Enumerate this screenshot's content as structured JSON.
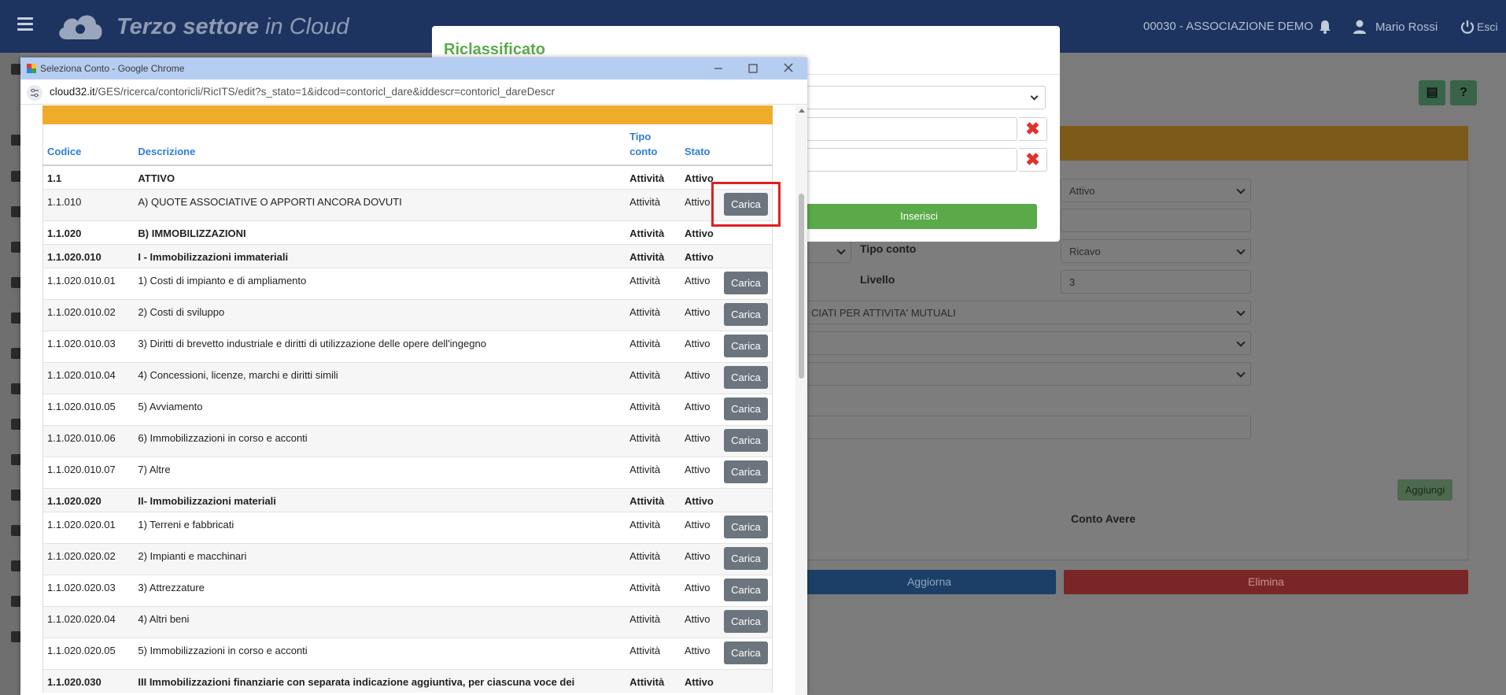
{
  "app": {
    "brand_bold": "Terzo settore",
    "brand_light": " in Cloud",
    "organization": "00030 - ASSOCIAZIONE DEMO",
    "user": "Mario Rossi",
    "logout": "Esci"
  },
  "background_form": {
    "stato_value": "Attivo",
    "tipo_conto_label": "Tipo conto",
    "tipo_conto_value": "Ricavo",
    "livello_label": "Livello",
    "livello_value": "3",
    "category_value": "CIATI PER ATTIVITA' MUTUALI",
    "aggiungi_label": "Aggiungi",
    "conto_avere_label": "Conto Avere",
    "aggiorna_label": "Aggiorna",
    "elimina_label": "Elimina"
  },
  "modal": {
    "title": "Riclassificato",
    "inserisci_label": "Inserisci",
    "clear_symbol": "✖"
  },
  "popup": {
    "window_title": "Seleziona Conto - Google Chrome",
    "url_host": "cloud32.it",
    "url_path": "/GES/ricerca/contoricli/RicITS/edit?s_stato=1&idcod=contoricl_dare&iddescr=contoricl_dareDescr",
    "table": {
      "headers": {
        "codice": "Codice",
        "descrizione": "Descrizione",
        "tipo_line1": "Tipo",
        "tipo_line2": "conto",
        "stato": "Stato"
      },
      "action_label": "Carica",
      "rows": [
        {
          "code": "1.1",
          "desc": "ATTIVO",
          "tipo": "Attività",
          "stato": "Attivo",
          "group": true
        },
        {
          "code": "1.1.010",
          "desc": "A) QUOTE ASSOCIATIVE O APPORTI ANCORA DOVUTI",
          "tipo": "Attività",
          "stato": "Attivo",
          "group": false
        },
        {
          "code": "1.1.020",
          "desc": "B) IMMOBILIZZAZIONI",
          "tipo": "Attività",
          "stato": "Attivo",
          "group": true
        },
        {
          "code": "1.1.020.010",
          "desc": "I - Immobilizzazioni immateriali",
          "tipo": "Attività",
          "stato": "Attivo",
          "group": true
        },
        {
          "code": "1.1.020.010.01",
          "desc": "1) Costi di impianto e di ampliamento",
          "tipo": "Attività",
          "stato": "Attivo",
          "group": false
        },
        {
          "code": "1.1.020.010.02",
          "desc": "2) Costi di sviluppo",
          "tipo": "Attività",
          "stato": "Attivo",
          "group": false
        },
        {
          "code": "1.1.020.010.03",
          "desc": "3) Diritti di brevetto industriale e diritti di utilizzazione delle opere dell'ingegno",
          "tipo": "Attività",
          "stato": "Attivo",
          "group": false
        },
        {
          "code": "1.1.020.010.04",
          "desc": "4) Concessioni, licenze, marchi e diritti simili",
          "tipo": "Attività",
          "stato": "Attivo",
          "group": false
        },
        {
          "code": "1.1.020.010.05",
          "desc": "5) Avviamento",
          "tipo": "Attività",
          "stato": "Attivo",
          "group": false
        },
        {
          "code": "1.1.020.010.06",
          "desc": "6) Immobilizzazioni in corso e acconti",
          "tipo": "Attività",
          "stato": "Attivo",
          "group": false
        },
        {
          "code": "1.1.020.010.07",
          "desc": "7) Altre",
          "tipo": "Attività",
          "stato": "Attivo",
          "group": false
        },
        {
          "code": "1.1.020.020",
          "desc": "II- Immobilizzazioni materiali",
          "tipo": "Attività",
          "stato": "Attivo",
          "group": true
        },
        {
          "code": "1.1.020.020.01",
          "desc": "1) Terreni e fabbricati",
          "tipo": "Attività",
          "stato": "Attivo",
          "group": false
        },
        {
          "code": "1.1.020.020.02",
          "desc": "2) Impianti e macchinari",
          "tipo": "Attività",
          "stato": "Attivo",
          "group": false
        },
        {
          "code": "1.1.020.020.03",
          "desc": "3) Attrezzature",
          "tipo": "Attività",
          "stato": "Attivo",
          "group": false
        },
        {
          "code": "1.1.020.020.04",
          "desc": "4) Altri beni",
          "tipo": "Attività",
          "stato": "Attivo",
          "group": false
        },
        {
          "code": "1.1.020.020.05",
          "desc": "5) Immobilizzazioni in corso e acconti",
          "tipo": "Attività",
          "stato": "Attivo",
          "group": false
        },
        {
          "code": "1.1.020.030",
          "desc": "III Immobilizzazioni finanziarie con separata indicazione aggiuntiva, per ciascuna voce dei",
          "tipo": "Attività",
          "stato": "Attivo",
          "group": true
        }
      ]
    }
  },
  "colors": {
    "topbar": "#1d3461",
    "accent_green": "#5aaa4a",
    "header_orange": "#efac2a",
    "link_blue": "#2f7ed8",
    "button_gray": "#6c757d",
    "highlight_red": "#e02020"
  }
}
